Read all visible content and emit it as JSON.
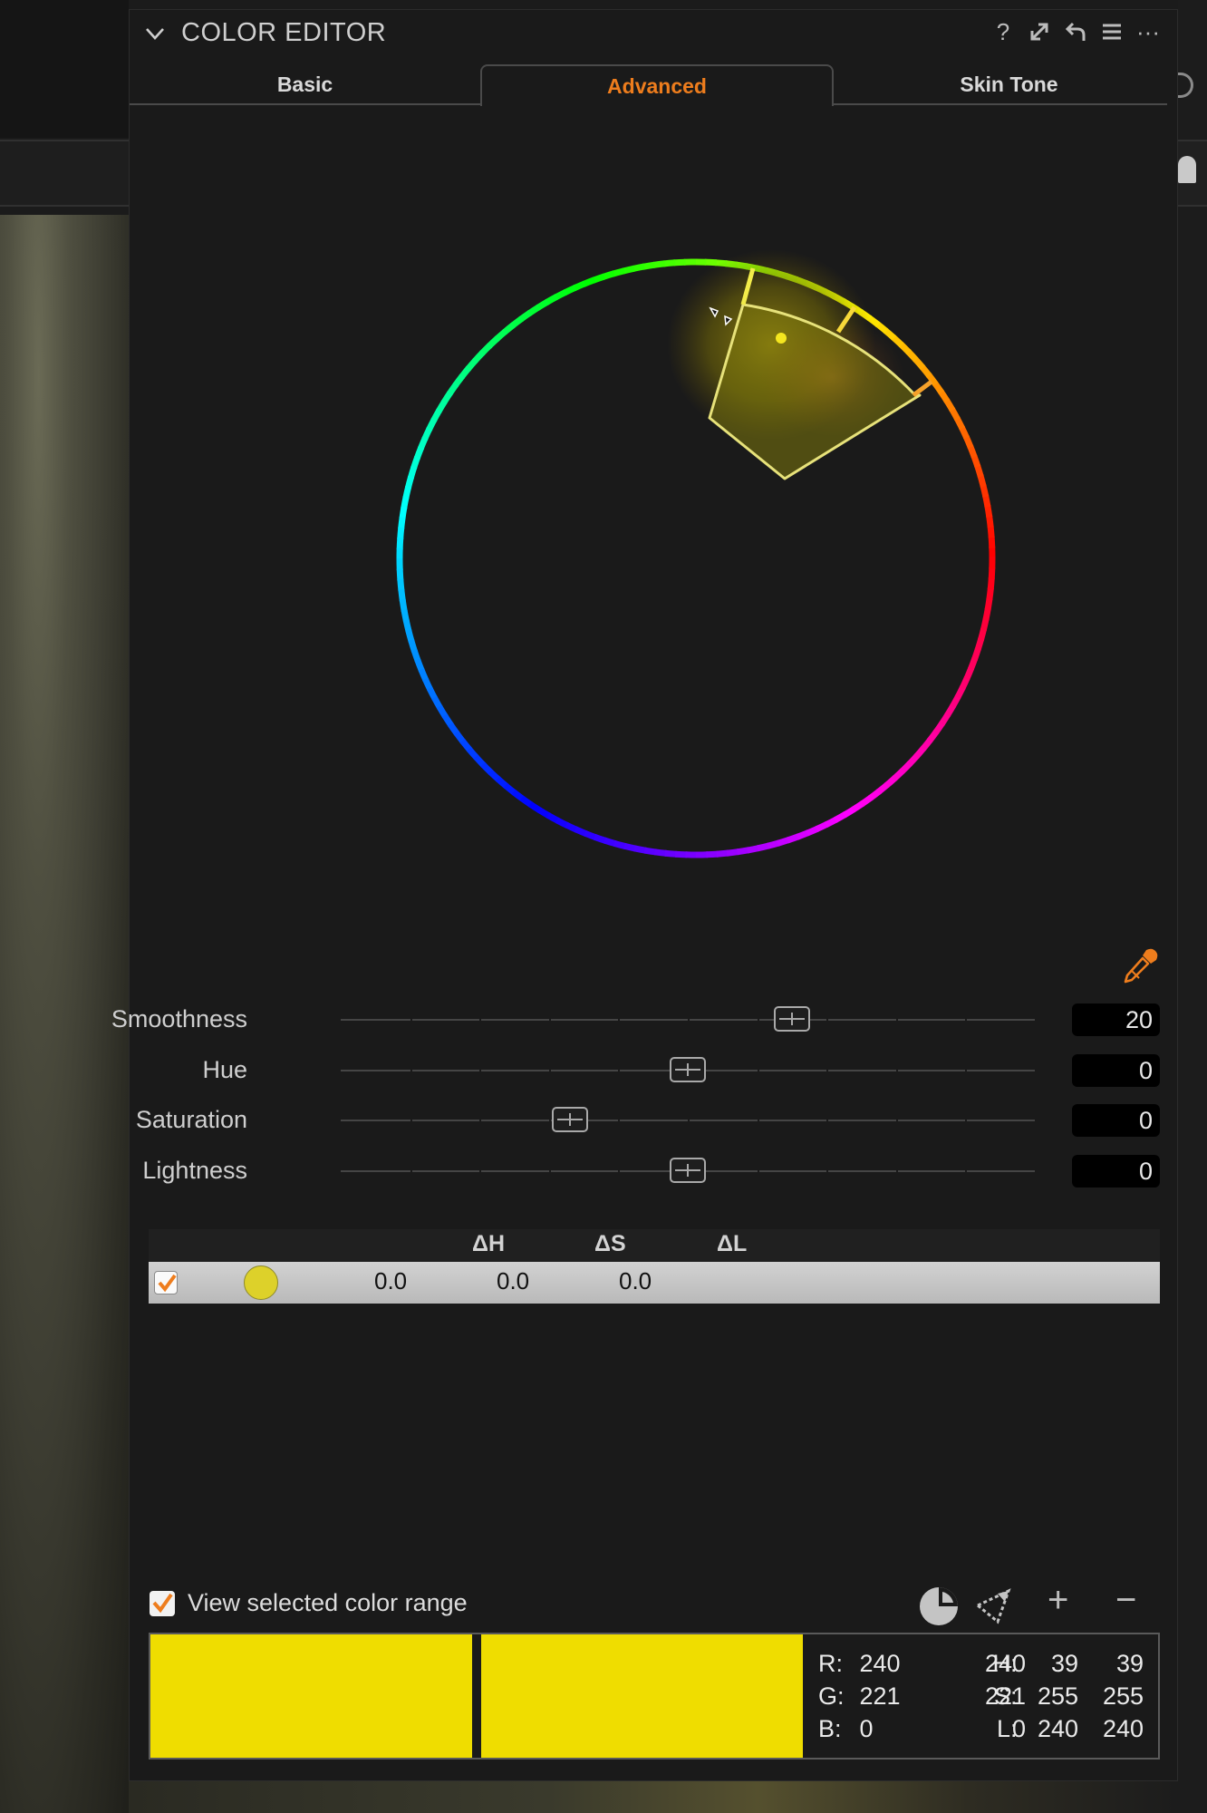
{
  "panel": {
    "title": "COLOR EDITOR",
    "header_icons": [
      "help-icon",
      "maximize-icon",
      "reset-icon",
      "menu-icon",
      "more-icon"
    ],
    "header_glyphs": {
      "help": "?",
      "more": "···"
    }
  },
  "tabs": [
    {
      "label": "Basic",
      "active": false
    },
    {
      "label": "Advanced",
      "active": true
    },
    {
      "label": "Skin Tone",
      "active": false
    }
  ],
  "colors": {
    "accent": "#ee7d1d",
    "selection": "#efdd00"
  },
  "sliders": [
    {
      "label": "Smoothness",
      "value": "20",
      "position": 0.65
    },
    {
      "label": "Hue",
      "value": "0",
      "position": 0.5
    },
    {
      "label": "Saturation",
      "value": "0",
      "position": 0.33
    },
    {
      "label": "Lightness",
      "value": "0",
      "position": 0.5
    }
  ],
  "color_list": {
    "headers": [
      "ΔH",
      "ΔS",
      "ΔL"
    ],
    "rows": [
      {
        "checked": true,
        "swatch": "#ddd12a",
        "dH": "0.0",
        "dS": "0.0",
        "dL": "0.0"
      }
    ]
  },
  "view_range": {
    "label": "View selected color range",
    "checked": true
  },
  "footer_controls": {
    "add": "+",
    "remove": "−"
  },
  "readout": {
    "R": {
      "label": "R:",
      "a": "240",
      "b": "240"
    },
    "G": {
      "label": "G:",
      "a": "221",
      "b": "221"
    },
    "B": {
      "label": "B:",
      "a": "0",
      "b": "0"
    },
    "H": {
      "label": "H:",
      "a": "39",
      "b": "39"
    },
    "S": {
      "label": "S:",
      "a": "255",
      "b": "255"
    },
    "L": {
      "label": "L:",
      "a": "240",
      "b": "240"
    }
  }
}
